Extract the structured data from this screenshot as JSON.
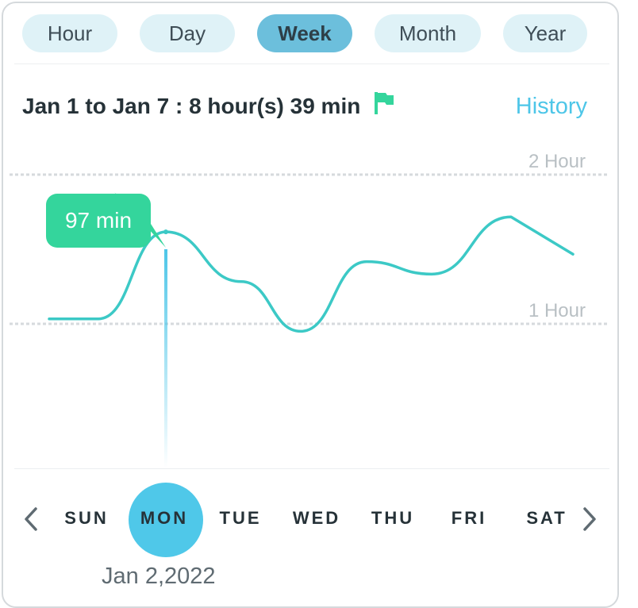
{
  "tabs": [
    {
      "label": "Hour",
      "active": false
    },
    {
      "label": "Day",
      "active": false
    },
    {
      "label": "Week",
      "active": true
    },
    {
      "label": "Month",
      "active": false
    },
    {
      "label": "Year",
      "active": false
    }
  ],
  "summary": {
    "text": "Jan 1 to Jan 7 : 8 hour(s) 39 min",
    "flag_icon": "flag-icon",
    "flag_color": "#34d59c"
  },
  "history_link": "History",
  "chart": {
    "grid_labels": {
      "top": "2 Hour",
      "middle": "1 Hour"
    },
    "tooltip": "97 min",
    "line_color": "#3cc9c6",
    "accent_color": "#34d59c"
  },
  "chart_data": {
    "type": "line",
    "categories": [
      "SUN",
      "MON",
      "TUE",
      "WED",
      "THU",
      "FRI",
      "SAT"
    ],
    "values": [
      62,
      97,
      77,
      57,
      85,
      80,
      103
    ],
    "unit": "min",
    "y_gridlines_min": [
      60,
      120
    ],
    "selected_index": 1
  },
  "days": [
    "SUN",
    "MON",
    "TUE",
    "WED",
    "THU",
    "FRI",
    "SAT"
  ],
  "selected_day": "MON",
  "selected_date": "Jan 2,2022",
  "nav": {
    "prev_icon": "chevron-left-icon",
    "next_icon": "chevron-right-icon"
  }
}
